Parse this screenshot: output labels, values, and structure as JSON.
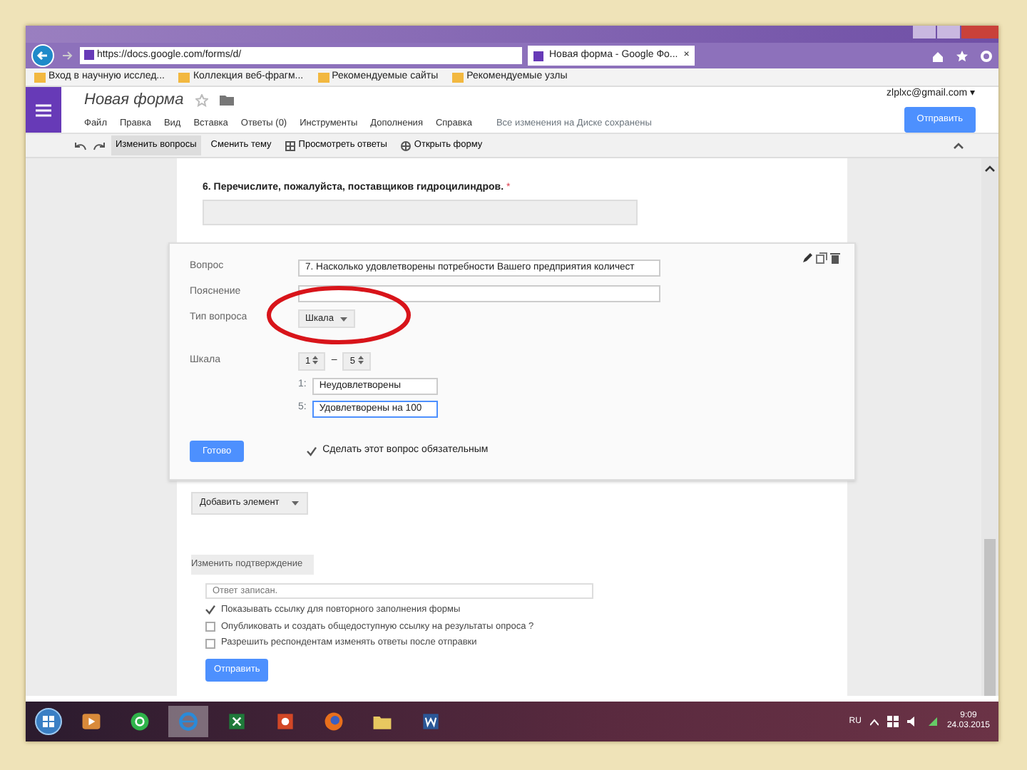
{
  "browser": {
    "url": "https://docs.google.com/forms/d/",
    "tab_title": "Новая форма - Google Фо...",
    "tab_close": "×",
    "bookmarks": [
      "Вход в научную исслед...",
      "Коллекция веб-фрагм...",
      "Рекомендуемые сайты",
      "Рекомендуемые узлы"
    ]
  },
  "form_header": {
    "title": "Новая форма",
    "menu": [
      "Файл",
      "Правка",
      "Вид",
      "Вставка",
      "Ответы (0)",
      "Инструменты",
      "Дополнения",
      "Справка"
    ],
    "save_status": "Все изменения на Диске сохранены",
    "account": "zlplxc@gmail.com ▾",
    "send_button": "Отправить"
  },
  "toolbar": [
    {
      "label": "Изменить вопросы",
      "selected": true,
      "kind": "plain"
    },
    {
      "label": "Сменить тему",
      "selected": false,
      "kind": "plain"
    },
    {
      "label": "Просмотреть ответы",
      "selected": false,
      "kind": "sheet"
    },
    {
      "label": "Открыть форму",
      "selected": false,
      "kind": "globe"
    }
  ],
  "question": {
    "title": "6. Перечислите, пожалуйста, поставщиков гидроцилиндров.",
    "required_mark": "*"
  },
  "editor": {
    "fields": [
      {
        "label": "Вопрос",
        "value": "7. Насколько удовлетворены потребности Вашего предприятия количест"
      },
      {
        "label": "Пояснение"
      }
    ],
    "type_label": "Тип вопроса",
    "type_value": "Шкала",
    "scale_label": "Шкала",
    "scale_from": "1",
    "scale_dash": "–",
    "scale_to": "5",
    "scale_labels": [
      {
        "number": "1:",
        "value": "Неудовлетворены",
        "focused": false
      },
      {
        "number": "5:",
        "value": "Удовлетворены на 100",
        "focused": true
      }
    ],
    "done_button": "Готово",
    "required": {
      "label": "Сделать этот вопрос обязательным",
      "checked": true
    }
  },
  "add_item": "Добавить элемент",
  "confirmation": {
    "tab": "Изменить подтверждение",
    "message": "Ответ записан.",
    "options": [
      {
        "label": "Показывать ссылку для повторного заполнения формы",
        "checked": true
      },
      {
        "label": "Опубликовать и создать общедоступную ссылку на результаты опроса ?",
        "checked": false
      },
      {
        "label": "Разрешить респондентам изменять ответы после отправки",
        "checked": false
      }
    ],
    "submit_button": "Отправить"
  },
  "taskbar": {
    "apps": [
      {
        "kind": "media",
        "selected": false
      },
      {
        "kind": "chat",
        "selected": false
      },
      {
        "kind": "browser",
        "selected": true
      },
      {
        "kind": "sheet",
        "selected": false
      },
      {
        "kind": "slides",
        "selected": false
      },
      {
        "kind": "fox",
        "selected": false
      },
      {
        "kind": "folder",
        "selected": false
      },
      {
        "kind": "doc",
        "selected": false
      }
    ],
    "lang": "RU",
    "time": "9:09",
    "date": "24.03.2015"
  }
}
